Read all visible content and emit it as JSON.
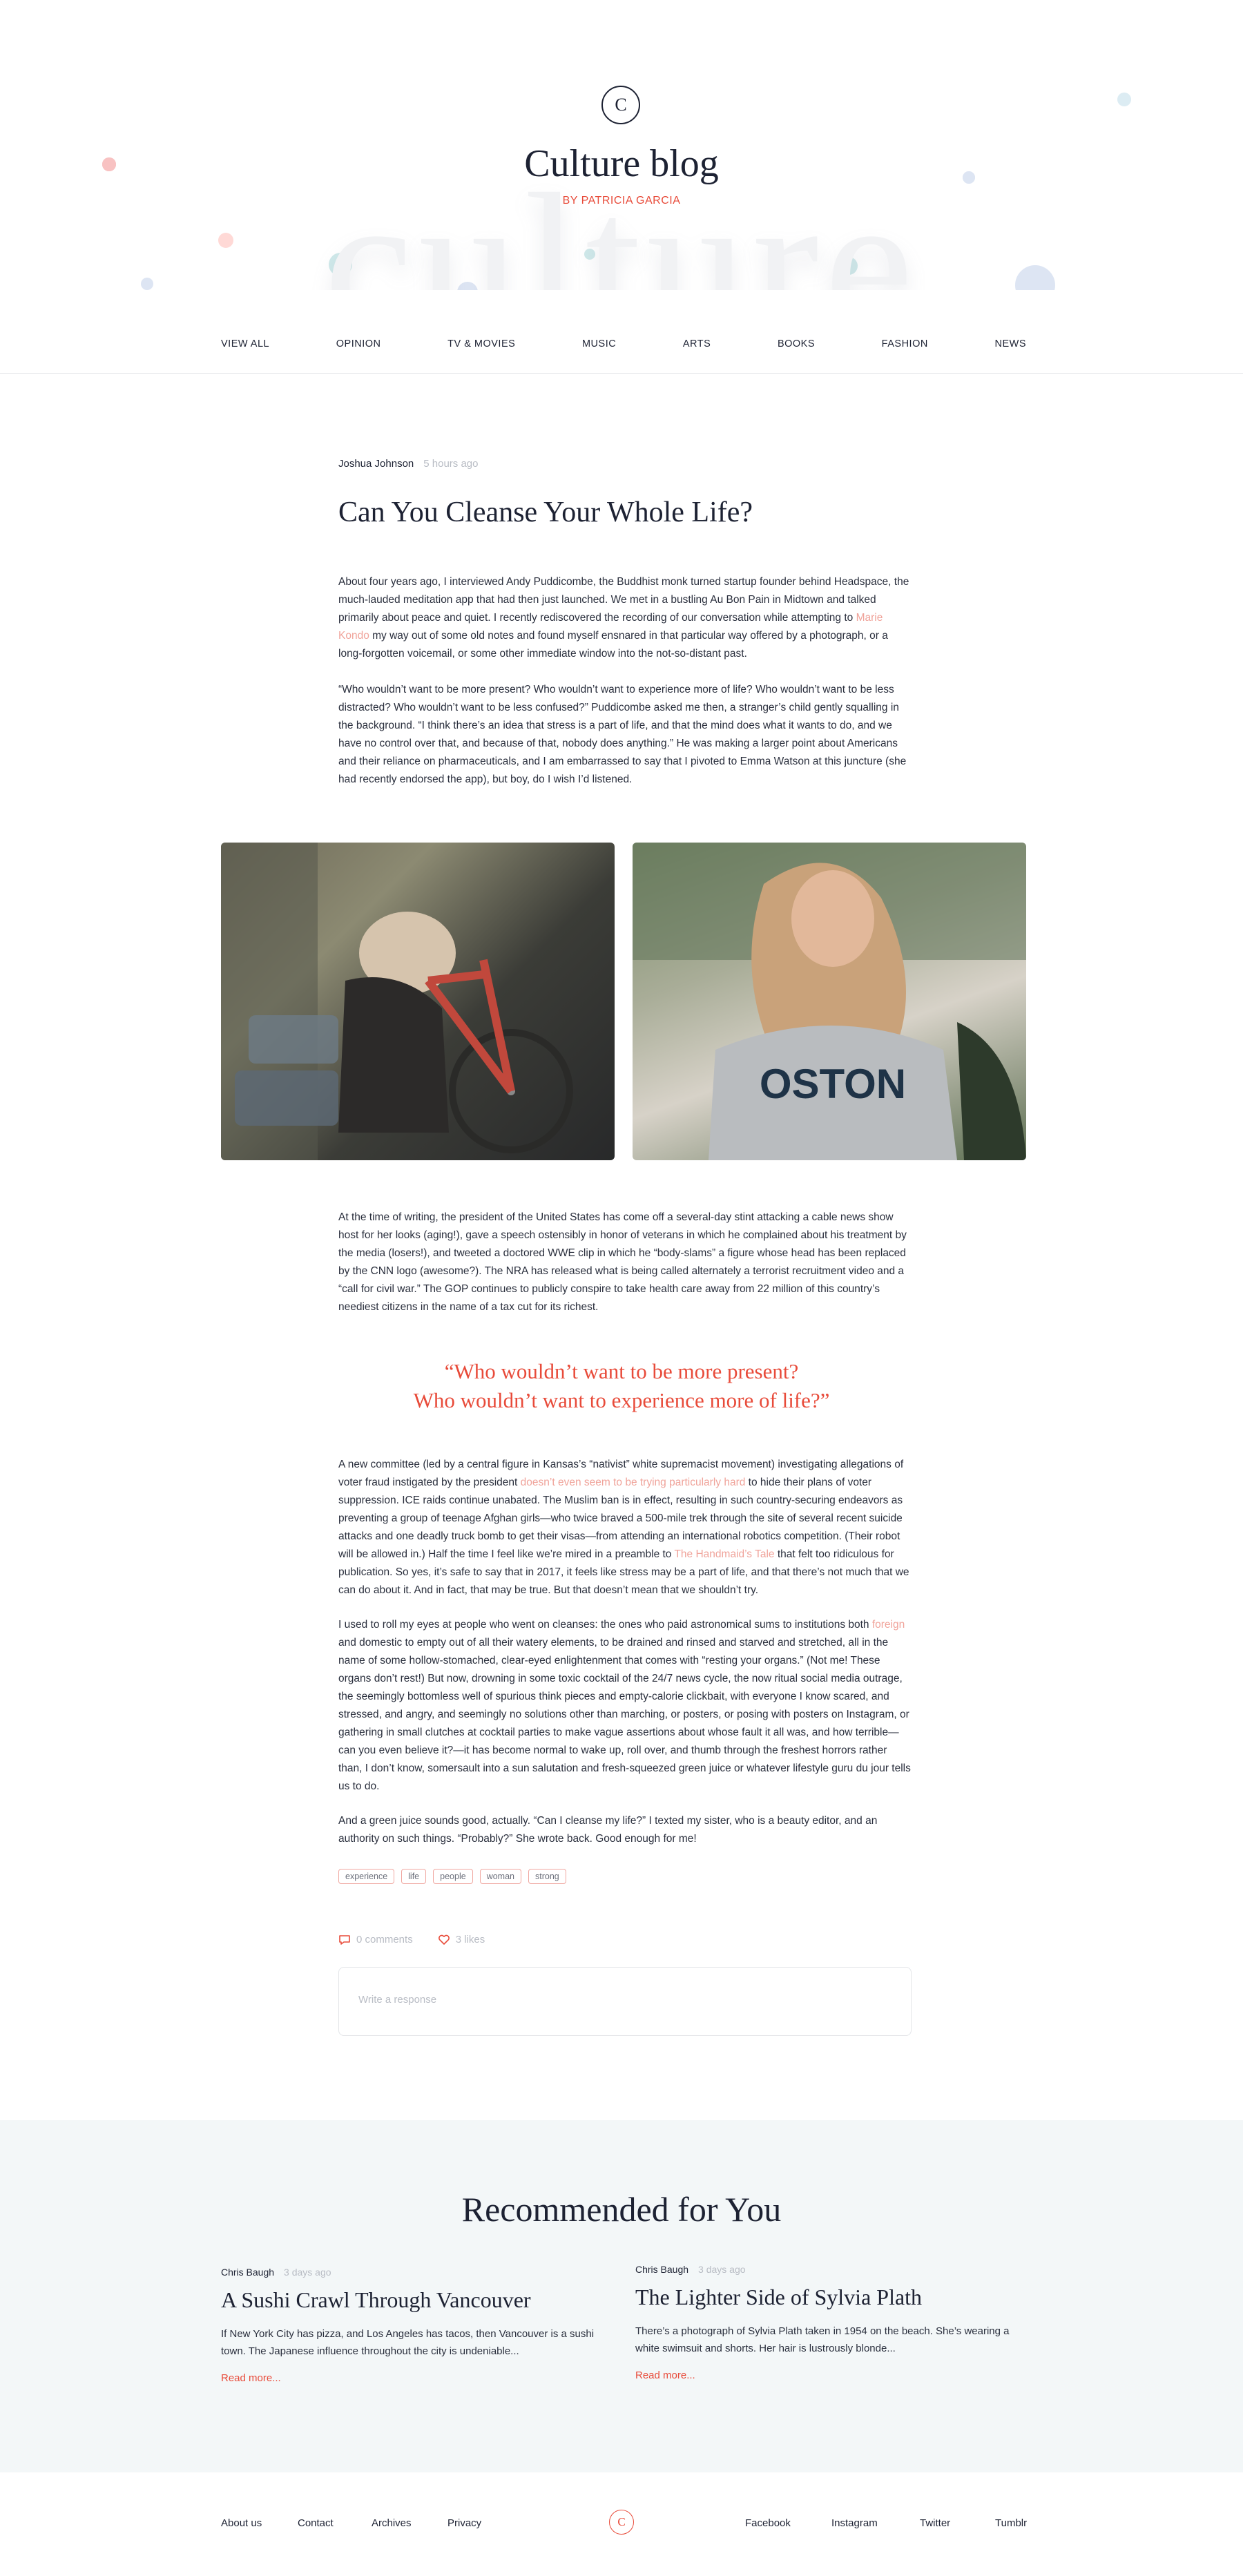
{
  "header": {
    "logo_letter": "C",
    "title": "Culture blog",
    "byline": "BY PATRICIA GARCIA",
    "background_word": "culture"
  },
  "nav": {
    "items": [
      {
        "label": "VIEW ALL"
      },
      {
        "label": "OPINION"
      },
      {
        "label": "TV & MOVIES"
      },
      {
        "label": "MUSIC"
      },
      {
        "label": "ARTS"
      },
      {
        "label": "BOOKS"
      },
      {
        "label": "FASHION"
      },
      {
        "label": "NEWS"
      }
    ]
  },
  "article": {
    "author": "Joshua Johnson",
    "time": "5 hours ago",
    "title": "Can You Cleanse Your Whole Life?",
    "p1": {
      "before": "About four years ago, I interviewed Andy Puddicombe, the Buddhist monk turned startup founder behind Headspace, the much-lauded meditation app that had then just launched. We met in a bustling Au Bon Pain in Midtown and talked primarily about peace and quiet. I recently rediscovered the recording of our conversation while attempting to ",
      "link": "Marie Kondo",
      "after": " my way out of some old notes and found myself ensnared in that particular way offered by a photograph, or a long-forgotten voicemail, or some other immediate window into the not-so-distant past."
    },
    "p2": "“Who wouldn’t want to be more present? Who wouldn’t want to experience more of life? Who wouldn’t want to be less distracted? Who wouldn’t want to be less confused?” Puddicombe asked me then, a stranger’s child gently squalling in the background. “I think there’s an idea that stress is a part of life, and that the mind does what it wants to do, and we have no control over that, and because of that, nobody does anything.” He was making a larger point about Americans and their reliance on pharmaceuticals, and I am embarrassed to say that I pivoted to Emma Watson at this juncture (she had recently endorsed the app), but boy, do I wish I’d listened.",
    "p3": "At the time of writing, the president of the United States has come off a several-day stint attacking a cable news show host for her looks (aging!), gave a speech ostensibly in honor of veterans in which he complained about his treatment by the media (losers!), and tweeted a doctored WWE clip in which he “body-slams” a figure whose head has been replaced by the CNN logo (awesome?). The NRA has released what is being called alternately a terrorist recruitment video and a “call for civil war.” The GOP continues to publicly conspire to take health care away from 22 million of this country’s neediest citizens in the name of a tax cut for its richest.",
    "quote_line1": "“Who wouldn’t want to be more present?",
    "quote_line2": "Who wouldn’t want to experience more of life?”",
    "p4": {
      "part1": "A new committee (led by a central figure in Kansas’s “nativist” white supremacist movement) investigating allegations of voter fraud instigated by the president ",
      "link1": "doesn’t even seem to be trying particularly hard",
      "part2": " to hide their plans of voter suppression. ICE raids continue unabated. The Muslim ban is in effect, resulting in such country-securing endeavors as preventing a group of teenage Afghan girls—who twice braved a 500-mile trek through the site of several recent suicide attacks and one deadly truck bomb to get their visas—from attending an international robotics competition. (Their robot will be allowed in.) Half the time I feel like we’re mired in a preamble to ",
      "link2": "The Handmaid’s Tale",
      "part3": " that felt too ridiculous for publication. So yes, it’s safe to say that in 2017, it feels like stress may be a part of life, and that there’s not much that we can do about it. And in fact, that may be true. But that doesn’t mean that we shouldn’t try."
    },
    "p5": {
      "part1": "I used to roll my eyes at people who went on cleanses: the ones who paid astronomical sums to institutions both ",
      "link": "foreign",
      "part2": " and domestic to empty out of all their watery elements, to be drained and rinsed and starved and stretched, all in the name of some hollow-stomached, clear-eyed enlightenment that comes with “resting your organs.” (Not me! These organs don’t rest!) But now, drowning in some toxic cocktail of the 24/7 news cycle, the now ritual social media outrage, the seemingly bottomless well of spurious think pieces and empty-calorie clickbait, with everyone I know scared, and stressed, and angry, and seemingly no solutions other than marching, or posters, or posing with posters on Instagram, or gathering in small clutches at cocktail parties to make vague assertions about whose fault it all was, and how terrible—can you even believe it?—it has become normal to wake up, roll over, and thumb through the freshest horrors rather than, I don’t know, somersault into a sun salutation and fresh-squeezed green juice or whatever lifestyle guru du jour tells us to do."
    },
    "p6": "And a green juice sounds good, actually. “Can I cleanse my life?” I texted my sister, who is a beauty editor, and an authority on such things. “Probably?” She wrote back. Good enough for me!",
    "tags": [
      "experience",
      "life",
      "people",
      "woman",
      "strong"
    ],
    "comments": "0 comments",
    "likes": "3 likes",
    "response_placeholder": "Write a response"
  },
  "recommended": {
    "title": "Recommended for You",
    "cards": [
      {
        "author": "Chris Baugh",
        "time": "3 days ago",
        "title": "A Sushi Crawl Through Vancouver",
        "excerpt": "If New York City has pizza, and Los Angeles has tacos, then Vancouver is a sushi town. The Japanese influence throughout the city is undeniable...",
        "read_more": "Read more..."
      },
      {
        "author": "Chris Baugh",
        "time": "3 days ago",
        "title": "The Lighter Side of Sylvia Plath",
        "excerpt": "There’s a photograph of Sylvia Plath taken in 1954 on the beach. She’s wearing a white swimsuit and shorts. Her hair is lustrously blonde...",
        "read_more": "Read more..."
      }
    ]
  },
  "footer": {
    "left_links": [
      "About us",
      "Contact",
      "Archives",
      "Privacy"
    ],
    "logo_letter": "C",
    "right_links": [
      "Facebook",
      "Instagram",
      "Twitter",
      "Tumblr"
    ]
  },
  "colors": {
    "accent": "#e84b3a",
    "link": "#f0a39a",
    "text": "#1d2233",
    "muted": "#b8bcc4",
    "recommended_bg": "#f3f7f8"
  },
  "icons": {
    "comments": "comment-icon",
    "likes": "heart-icon"
  }
}
